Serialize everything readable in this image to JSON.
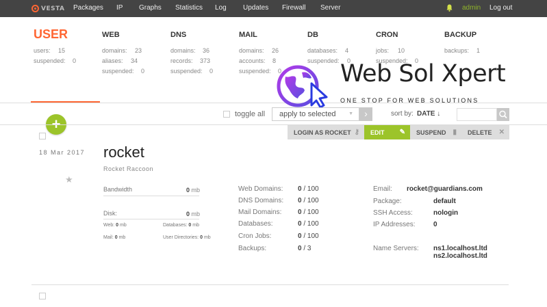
{
  "brand": {
    "logo_text": "VESTA",
    "accent": "#ff6633",
    "green": "#9cc42a"
  },
  "nav": {
    "items": [
      "Packages",
      "IP",
      "Graphs",
      "Statistics",
      "Log",
      "Updates",
      "Firewall",
      "Server"
    ],
    "user": "admin",
    "logout": "Log out"
  },
  "stats": {
    "user": {
      "title": "USER",
      "rows": [
        [
          "users:",
          "15"
        ],
        [
          "suspended:",
          "0"
        ]
      ]
    },
    "web": {
      "title": "WEB",
      "rows": [
        [
          "domains:",
          "23"
        ],
        [
          "aliases:",
          "34"
        ],
        [
          "suspended:",
          "0"
        ]
      ]
    },
    "dns": {
      "title": "DNS",
      "rows": [
        [
          "domains:",
          "36"
        ],
        [
          "records:",
          "373"
        ],
        [
          "suspended:",
          "0"
        ]
      ]
    },
    "mail": {
      "title": "MAIL",
      "rows": [
        [
          "domains:",
          "26"
        ],
        [
          "accounts:",
          "8"
        ],
        [
          "suspended:",
          "0"
        ]
      ]
    },
    "db": {
      "title": "DB",
      "rows": [
        [
          "databases:",
          "4"
        ],
        [
          "suspended:",
          "0"
        ]
      ]
    },
    "cron": {
      "title": "CRON",
      "rows": [
        [
          "jobs:",
          "10"
        ],
        [
          "suspended:",
          "0"
        ]
      ]
    },
    "backup": {
      "title": "BACKUP",
      "rows": [
        [
          "backups:",
          "1"
        ]
      ]
    }
  },
  "watermark": {
    "title": "Web Sol Xpert",
    "subtitle": "ONE STOP FOR WEB SOLUTIONS"
  },
  "toolbar": {
    "toggle_all": "toggle all",
    "apply_selected": "apply to selected",
    "sort_by": "sort by:",
    "sort_key": "DATE ↓",
    "search_placeholder": ""
  },
  "row": {
    "date": "18 Mar 2017",
    "username": "rocket",
    "fullname": "Rocket Raccoon",
    "actions": {
      "login": "LOGIN AS ROCKET",
      "edit": "EDIT",
      "suspend": "SUSPEND",
      "delete": "DELETE"
    },
    "bandwidth": {
      "label": "Bandwidth",
      "value": "0",
      "unit": "mb"
    },
    "disk": {
      "label": "Disk:",
      "value": "0",
      "unit": "mb"
    },
    "disk_detail": {
      "web_label": "Web:",
      "web_val": "0",
      "web_unit": "mb",
      "db_label": "Databases:",
      "db_val": "0",
      "db_unit": "mb",
      "mail_label": "Mail:",
      "mail_val": "0",
      "mail_unit": "mb",
      "userdir_label": "User Directories:",
      "userdir_val": "0",
      "userdir_unit": "mb"
    },
    "limits": [
      {
        "label": "Web Domains:",
        "used": "0",
        "total": "/ 100"
      },
      {
        "label": "DNS Domains:",
        "used": "0",
        "total": "/ 100"
      },
      {
        "label": "Mail Domains:",
        "used": "0",
        "total": "/ 100"
      },
      {
        "label": "Databases:",
        "used": "0",
        "total": "/ 100"
      },
      {
        "label": "Cron Jobs:",
        "used": "0",
        "total": "/ 100"
      },
      {
        "label": "Backups:",
        "used": "0",
        "total": "/ 3"
      }
    ],
    "info": {
      "email_label": "Email:",
      "email": "rocket@guardians.com",
      "package_label": "Package:",
      "package": "default",
      "ssh_label": "SSH Access:",
      "ssh": "nologin",
      "ip_label": "IP Addresses:",
      "ip": "0",
      "ns_label": "Name Servers:",
      "ns1": "ns1.localhost.ltd",
      "ns2": "ns2.localhost.ltd"
    }
  }
}
